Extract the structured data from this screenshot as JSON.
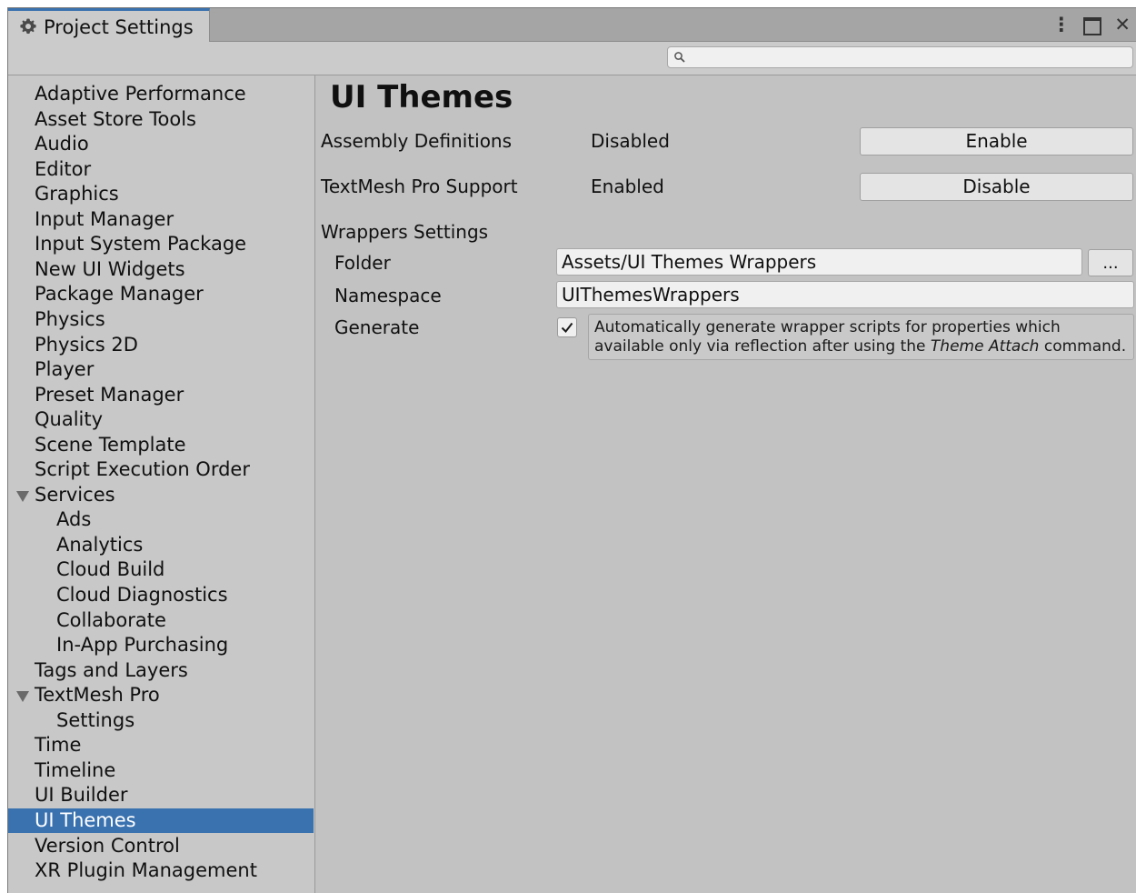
{
  "window": {
    "tab_title": "Project Settings",
    "close_glyph": "✕",
    "kebab_glyph": "⋮"
  },
  "search": {
    "placeholder": ""
  },
  "sidebar": {
    "selected": "UI Themes",
    "items": [
      {
        "label": "Adaptive Performance",
        "indent": 0
      },
      {
        "label": "Asset Store Tools",
        "indent": 0
      },
      {
        "label": "Audio",
        "indent": 0
      },
      {
        "label": "Editor",
        "indent": 0
      },
      {
        "label": "Graphics",
        "indent": 0
      },
      {
        "label": "Input Manager",
        "indent": 0
      },
      {
        "label": "Input System Package",
        "indent": 0
      },
      {
        "label": "New UI Widgets",
        "indent": 0
      },
      {
        "label": "Package Manager",
        "indent": 0
      },
      {
        "label": "Physics",
        "indent": 0
      },
      {
        "label": "Physics 2D",
        "indent": 0
      },
      {
        "label": "Player",
        "indent": 0
      },
      {
        "label": "Preset Manager",
        "indent": 0
      },
      {
        "label": "Quality",
        "indent": 0
      },
      {
        "label": "Scene Template",
        "indent": 0
      },
      {
        "label": "Script Execution Order",
        "indent": 0
      },
      {
        "label": "Services",
        "indent": 0,
        "expanded": true
      },
      {
        "label": "Ads",
        "indent": 1
      },
      {
        "label": "Analytics",
        "indent": 1
      },
      {
        "label": "Cloud Build",
        "indent": 1
      },
      {
        "label": "Cloud Diagnostics",
        "indent": 1
      },
      {
        "label": "Collaborate",
        "indent": 1
      },
      {
        "label": "In-App Purchasing",
        "indent": 1
      },
      {
        "label": "Tags and Layers",
        "indent": 0
      },
      {
        "label": "TextMesh Pro",
        "indent": 0,
        "expanded": true
      },
      {
        "label": "Settings",
        "indent": 1
      },
      {
        "label": "Time",
        "indent": 0
      },
      {
        "label": "Timeline",
        "indent": 0
      },
      {
        "label": "UI Builder",
        "indent": 0
      },
      {
        "label": "UI Themes",
        "indent": 0,
        "selected": true
      },
      {
        "label": "Version Control",
        "indent": 0
      },
      {
        "label": "XR Plugin Management",
        "indent": 0
      }
    ]
  },
  "main": {
    "title": "UI Themes",
    "assembly": {
      "label": "Assembly Definitions",
      "status": "Disabled",
      "button": "Enable"
    },
    "textmeshpro": {
      "label": "TextMesh Pro Support",
      "status": "Enabled",
      "button": "Disable"
    },
    "wrappers": {
      "section_label": "Wrappers Settings",
      "folder_label": "Folder",
      "folder_value": "Assets/UI Themes Wrappers",
      "browse_button": "...",
      "namespace_label": "Namespace",
      "namespace_value": "UIThemesWrappers",
      "generate_label": "Generate",
      "generate_checked": true,
      "help_text_before": "Automatically generate wrapper scripts for properties which available only via reflection after using the ",
      "help_text_em": "Theme Attach",
      "help_text_after": " command."
    }
  },
  "colors": {
    "selection": "#3a72b0",
    "panel": "#c2c2c2",
    "sidebar": "#c8c8c8",
    "button": "#e4e4e4"
  }
}
